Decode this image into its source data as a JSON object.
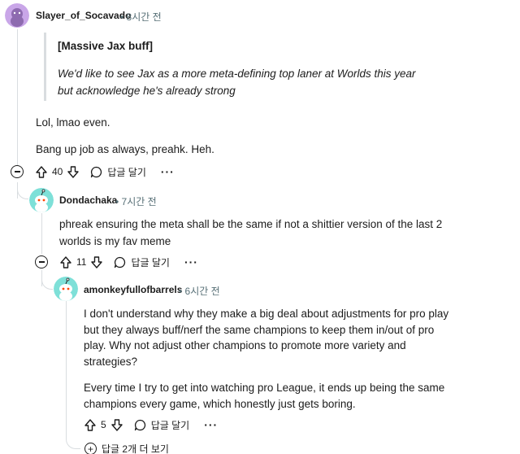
{
  "comment1": {
    "username": "Slayer_of_Socavado",
    "time": "8시간 전",
    "quote_title": "[Massive Jax buff]",
    "quote_text": "We'd like to see Jax as a more meta-defining top laner at Worlds this year but acknowledge he's already strong",
    "paragraph1": "Lol, lmao even.",
    "paragraph2": "Bang up job as always, preahk. Heh.",
    "votes": "40",
    "reply_label": "답글 달기",
    "more_label": "···",
    "avatar_color": "#c9a6e8"
  },
  "comment2": {
    "username": "Dondachaka",
    "time": "7시간 전",
    "body": "phreak ensuring the meta shall be the same if not a shittier version of the last 2 worlds is my fav meme",
    "votes": "11",
    "reply_label": "답글 달기",
    "more_label": "···",
    "avatar_color": "#7ee0d8"
  },
  "comment3": {
    "username": "amonkeyfullofbarrels",
    "time": "6시간 전",
    "paragraph1": "I don't understand why they make a big deal about adjustments for pro play but they always buff/nerf the same champions to keep them in/out of pro play. Why not adjust other champions to promote more variety and strategies?",
    "paragraph2": "Every time I try to get into watching pro League, it ends up being the same champions every game, which honestly just gets boring.",
    "votes": "5",
    "reply_label": "답글 달기",
    "more_label": "···",
    "avatar_color": "#7ee0d8"
  },
  "more_replies": {
    "label": "답글 2개 더 보기"
  },
  "separator": "•"
}
